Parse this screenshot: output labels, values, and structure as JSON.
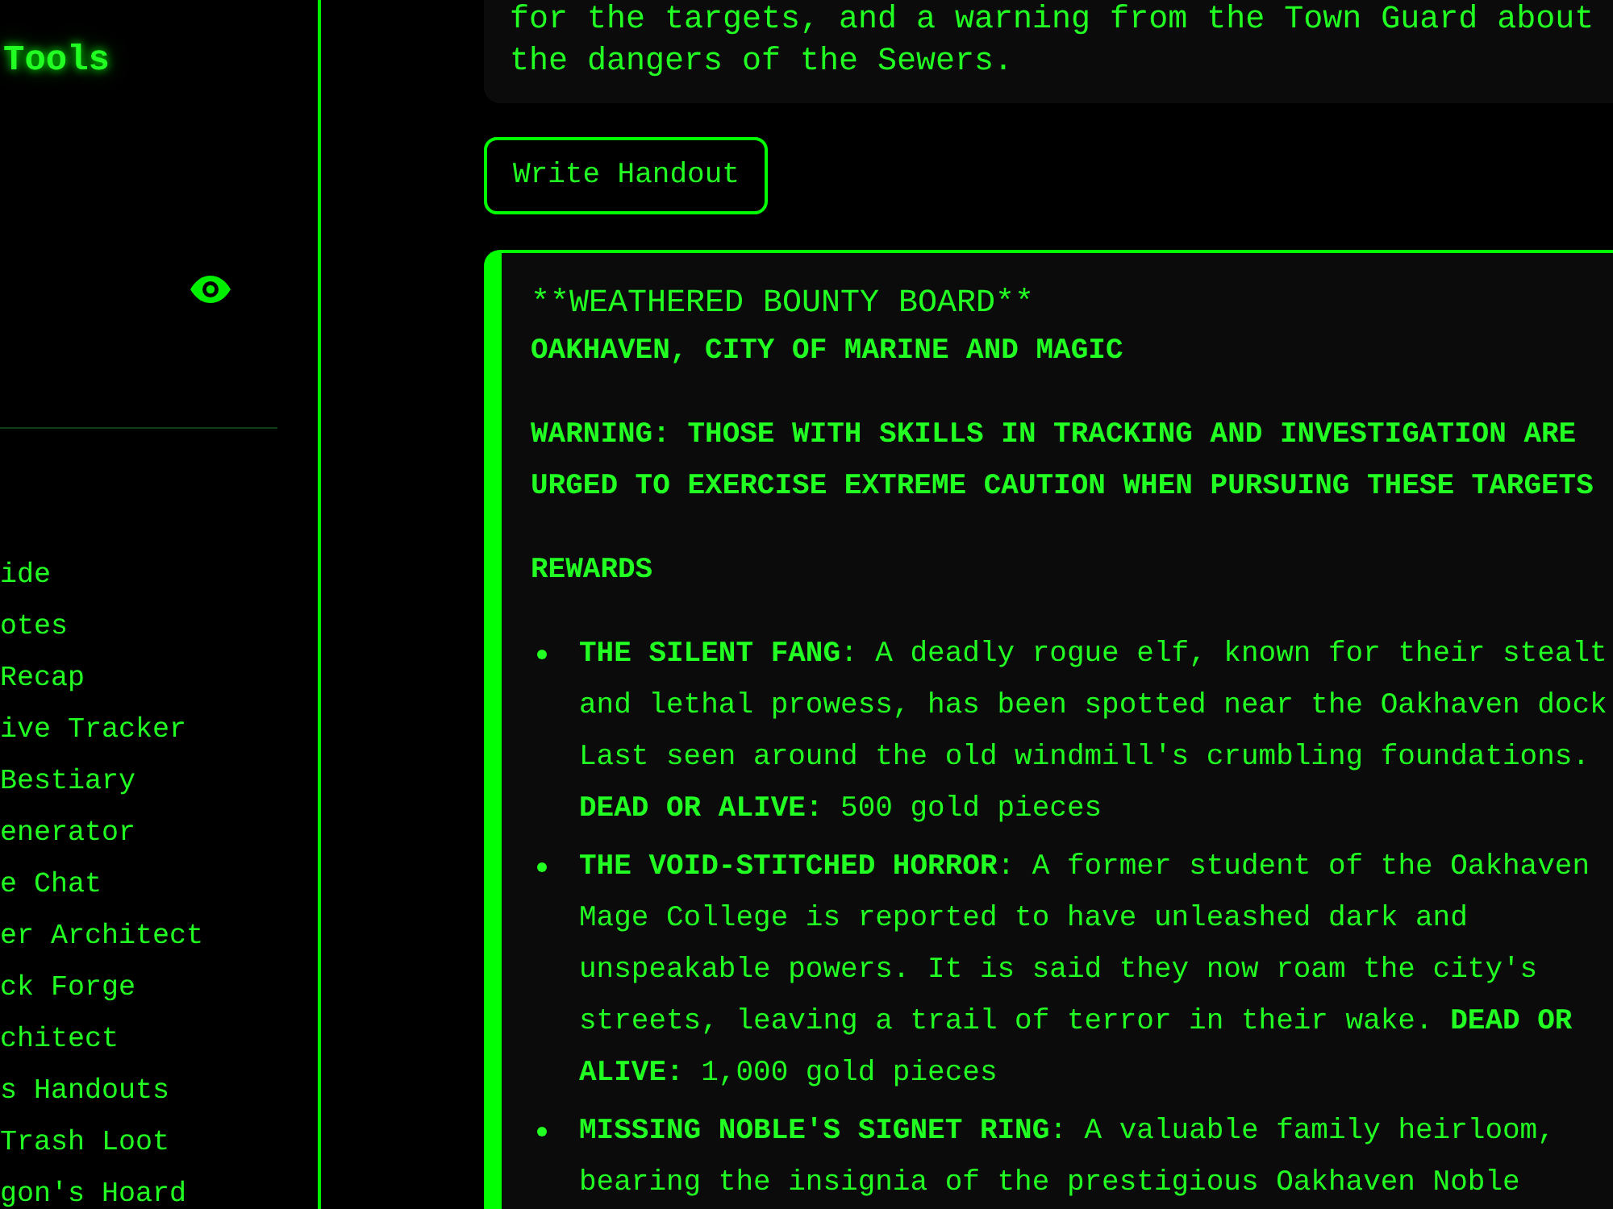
{
  "sidebar": {
    "title": "Tools",
    "nav_items": [
      "ide",
      "otes",
      "Recap",
      "ive Tracker",
      "Bestiary",
      "enerator",
      "e Chat",
      "er Architect",
      "ck Forge",
      "chitect",
      "s Handouts",
      "Trash Loot",
      "gon's Hoard"
    ]
  },
  "content": {
    "intro": "for the targets, and a warning from the Town Guard about the dangers of the Sewers.",
    "write_button": "Write Handout",
    "bounty_board": {
      "header": "**WEATHERED BOUNTY BOARD**",
      "subtitle": "OAKHAVEN, CITY OF MARINE AND MAGIC",
      "warning": "WARNING: THOSE WITH SKILLS IN TRACKING AND INVESTIGATION ARE URGED TO EXERCISE EXTREME CAUTION WHEN PURSUING THESE TARGETS",
      "section_heading": "REWARDS",
      "rewards": [
        "**THE SILENT FANG**: A deadly rogue elf, known for their stealt and lethal prowess, has been spotted near the Oakhaven dock Last seen around the old windmill's crumbling foundations. **DEAD OR ALIVE:** 500 gold pieces",
        "**THE VOID-STITCHED HORROR**: A former student of the Oakhaven Mage College is reported to have unleashed dark and unspeakable powers. It is said they now roam the city's streets, leaving a trail of terror in their wake. **DEAD OR ALIVE:** 1,000 gold pieces",
        "**MISSING NOBLE'S SIGNET RING**: A valuable family heirloom, bearing the insignia of the prestigious Oakhaven Noble"
      ]
    }
  }
}
